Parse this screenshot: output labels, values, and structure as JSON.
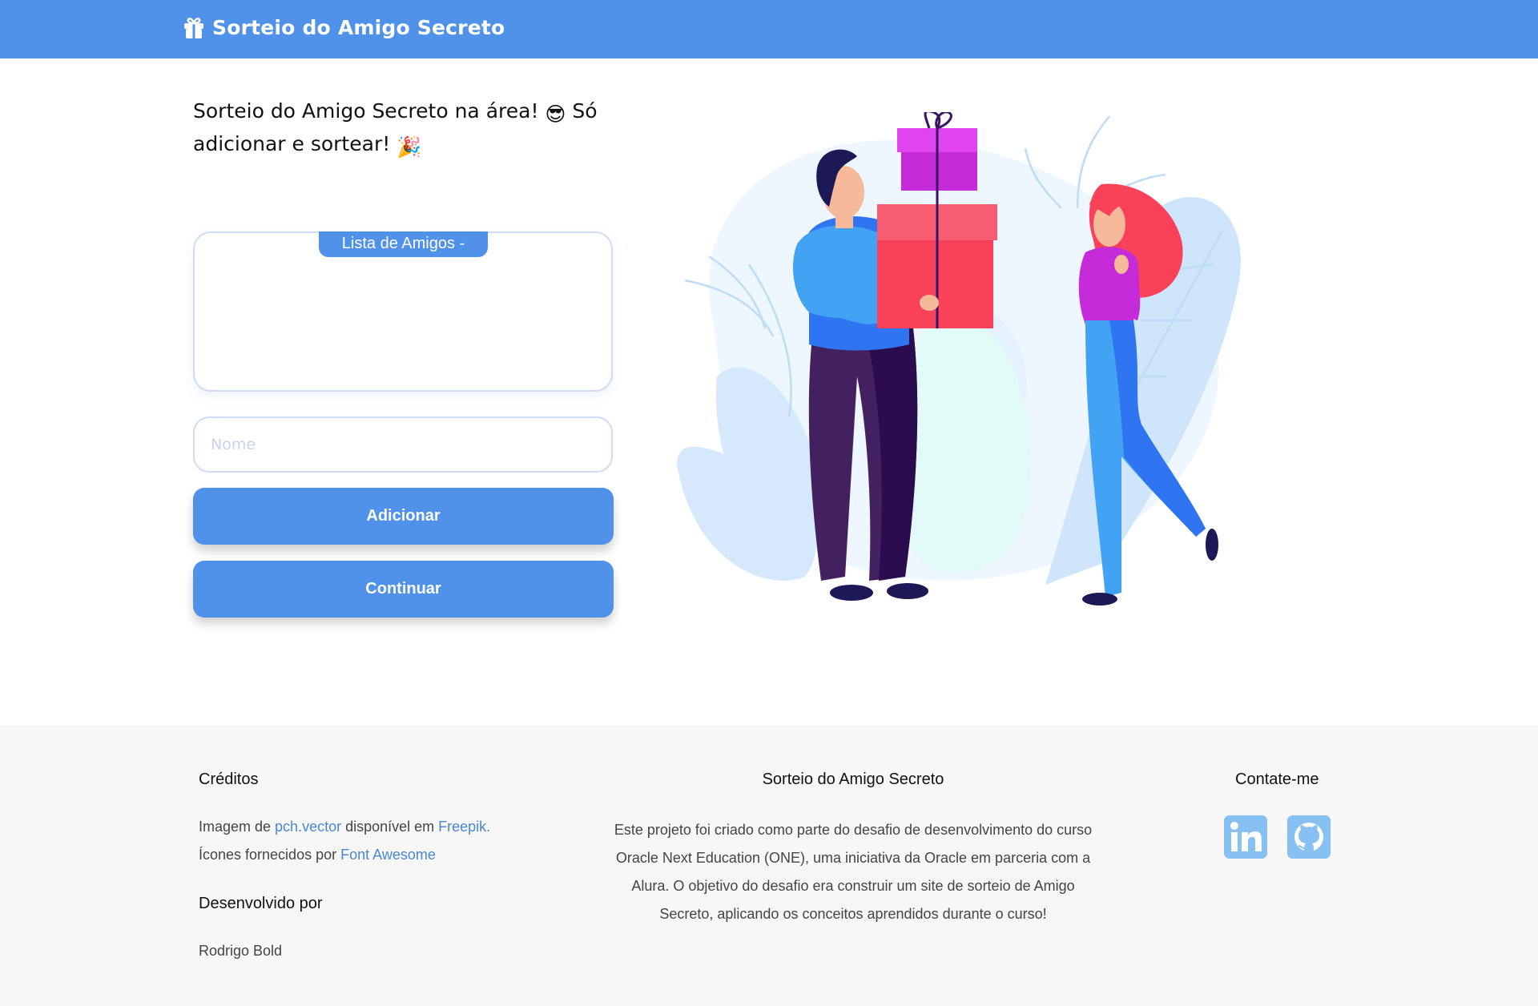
{
  "header": {
    "title": "Sorteio do Amigo Secreto",
    "icon": "gift-icon"
  },
  "main": {
    "headline": {
      "text1": "Sorteio do Amigo Secreto na área! ",
      "emoji1": "😎",
      "text2": " Só adicionar e sortear! ",
      "emoji2": "🎉"
    },
    "list_title": "Lista de Amigos -",
    "friends": [],
    "name_input": {
      "placeholder": "Nome",
      "value": ""
    },
    "add_button": "Adicionar",
    "continue_button": "Continuar"
  },
  "footer": {
    "credits": {
      "title": "Créditos",
      "image_prefix": "Imagem de ",
      "image_author": "pch.vector",
      "image_middle": " disponível em ",
      "image_site": "Freepik.",
      "icons_prefix": "Ícones fornecidos por ",
      "icons_site": "Font Awesome"
    },
    "developer": {
      "title": "Desenvolvido por",
      "name": "Rodrigo Bold"
    },
    "project": {
      "title": "Sorteio do Amigo Secreto",
      "description": "Este projeto foi criado como parte do desafio de desenvolvimento do curso Oracle Next Education (ONE), uma iniciativa da Oracle em parceria com a Alura. O objetivo do desafio era construir um site de sorteio de Amigo Secreto, aplicando os conceitos aprendidos durante o curso!"
    },
    "contact": {
      "title": "Contate-me",
      "links": [
        {
          "icon": "linkedin-icon"
        },
        {
          "icon": "github-icon"
        }
      ]
    }
  },
  "colors": {
    "primary": "#5092ea",
    "footer_bg": "#f7f7f7",
    "link": "#4a86d6",
    "social": "#87c0f3"
  }
}
